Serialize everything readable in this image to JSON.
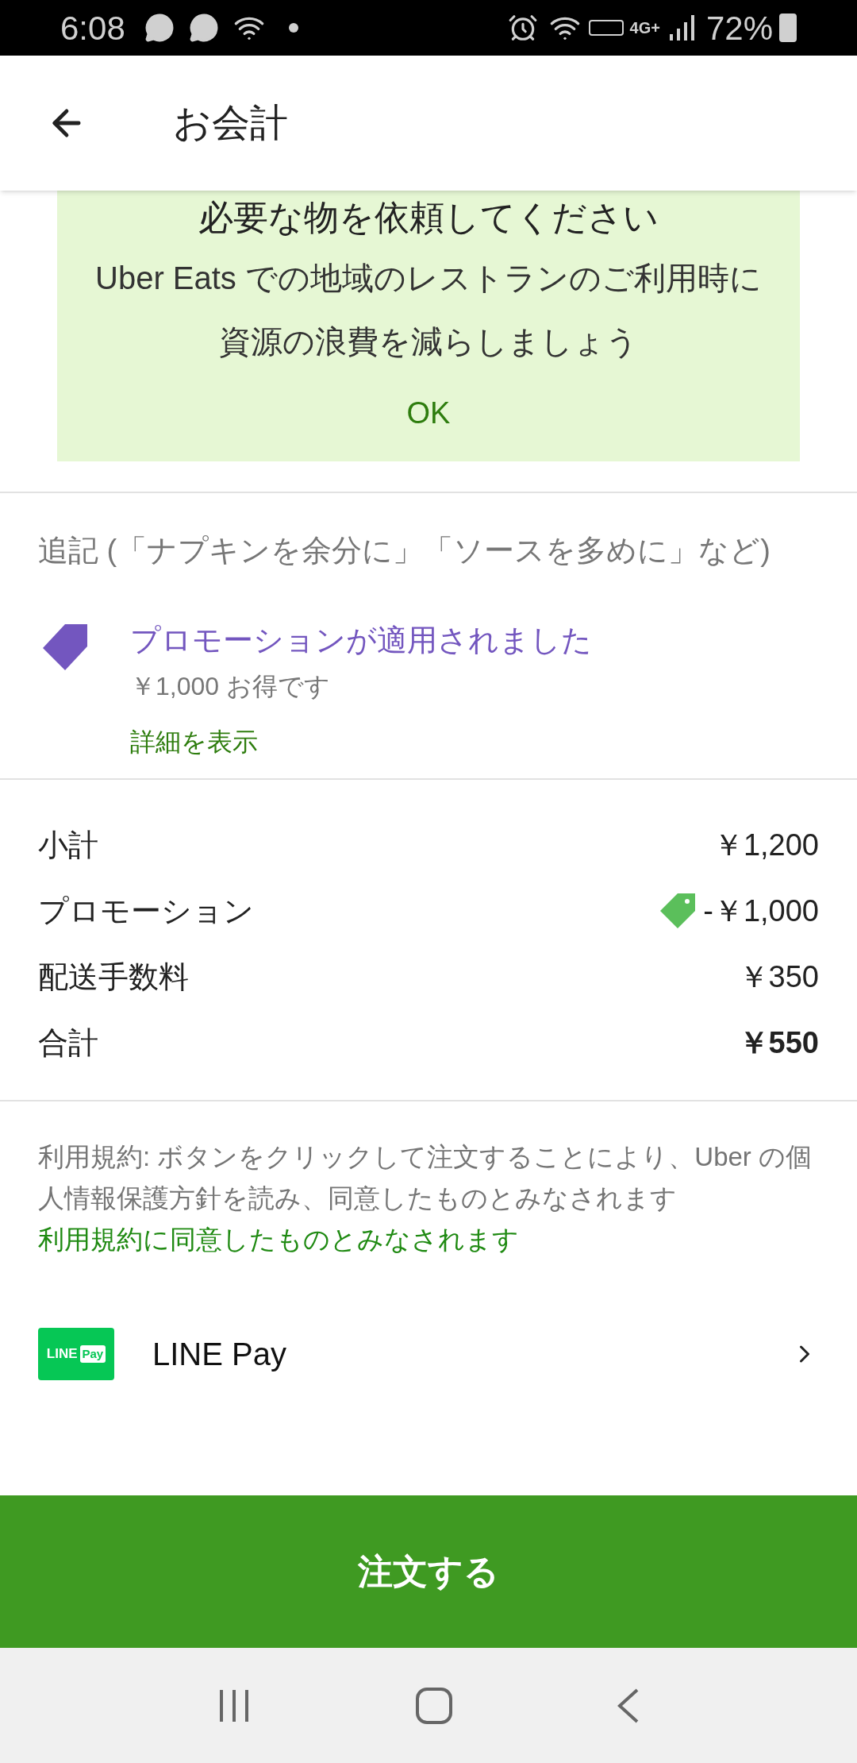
{
  "status_bar": {
    "time": "6:08",
    "network": "4G+",
    "battery": "72%"
  },
  "header": {
    "title": "お会計"
  },
  "banner": {
    "title": "必要な物を依頼してください",
    "body": "Uber Eats での地域のレストランのご利用時に資源の浪費を減らしましょう",
    "button": "OK"
  },
  "notes": {
    "placeholder": "追記 (「ナプキンを余分に」「ソースを多めに」など)"
  },
  "promotion": {
    "title": "プロモーションが適用されました",
    "savings": "￥1,000 お得です",
    "link": "詳細を表示"
  },
  "summary": [
    {
      "label": "小計",
      "value": "￥1,200",
      "kind": "plain"
    },
    {
      "label": "プロモーション",
      "value": "-￥1,000",
      "kind": "discount"
    },
    {
      "label": "配送手数料",
      "value": "￥350",
      "kind": "plain"
    },
    {
      "label": "合計",
      "value": "￥550",
      "kind": "total"
    }
  ],
  "terms": {
    "text": "利用規約: ボタンをクリックして注文することにより、Uber の個人情報保護方針を読み、同意したものとみなされます",
    "link": "利用規約に同意したものとみなされます"
  },
  "payment": {
    "logo_left": "LINE",
    "logo_right": "Pay",
    "name": "LINE Pay"
  },
  "order_button": "注文する"
}
